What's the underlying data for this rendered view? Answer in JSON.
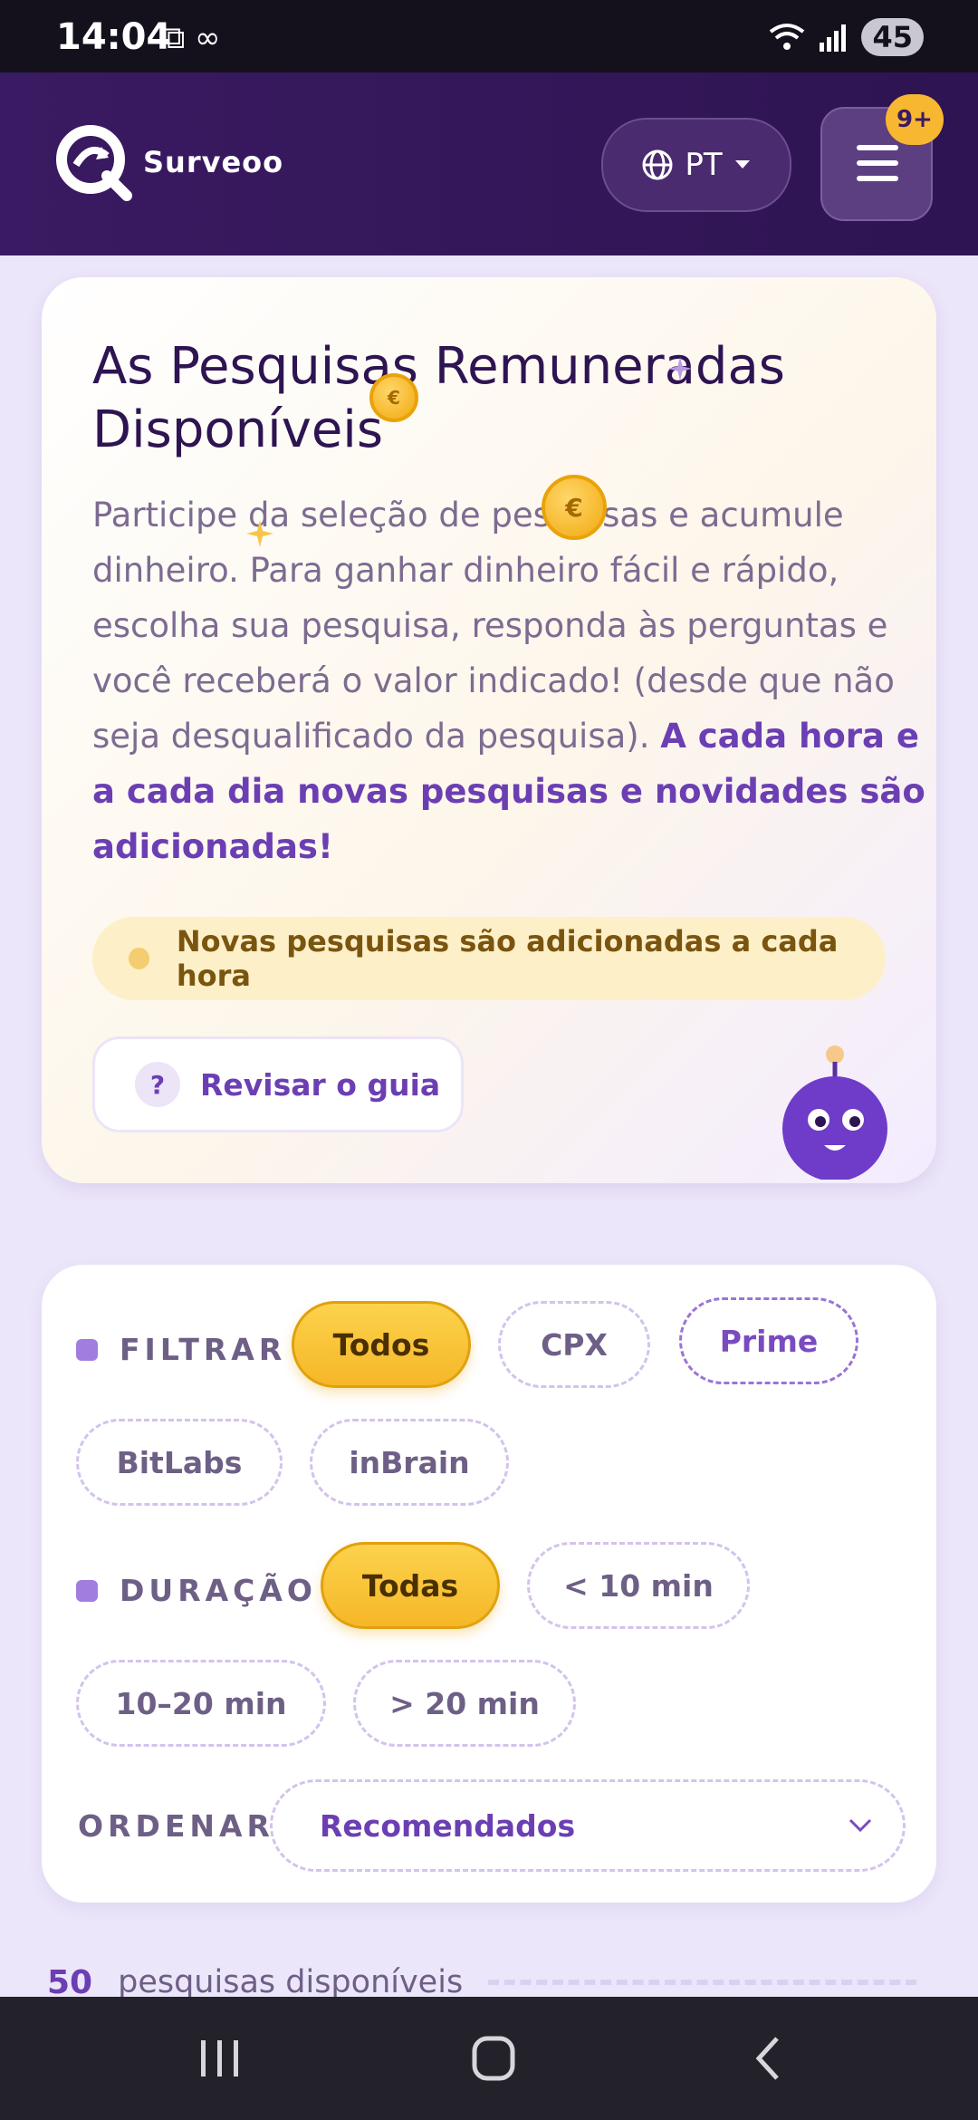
{
  "status_bar": {
    "time": "14:04",
    "left_icons": "⧉ ∞",
    "signal_icons": "📶",
    "battery": "45"
  },
  "header": {
    "brand": "Surveoo",
    "language": "PT",
    "notifications_badge": "9+"
  },
  "intro": {
    "title": "As Pesquisas Remuneradas Disponíveis",
    "body_regular": "Participe da seleção de pesquisas e acumule dinheiro. Para ganhar dinheiro fácil e rápido, escolha sua pesquisa, responda às perguntas e você receberá o valor indicado! (desde que não seja desqualificado da pesquisa). ",
    "body_bold": "A cada hora e a cada dia novas pesquisas e novidades são adicionadas!",
    "new_notice": "Novas pesquisas são adicionadas a cada hora",
    "guide_button": "Revisar o guia",
    "guide_icon_glyph": "?",
    "coin_glyph": "€"
  },
  "filters": {
    "filter_label": "FILTRAR",
    "filter_options": [
      "Todos",
      "CPX",
      "Prime",
      "BitLabs",
      "inBrain"
    ],
    "filter_selected": "Todos",
    "duration_label": "DURAÇÃO",
    "duration_options": [
      "Todas",
      "< 10 min",
      "10–20 min",
      "> 20 min"
    ],
    "duration_selected": "Todas",
    "sort_label": "ORDENAR",
    "sort_value": "Recomendados"
  },
  "results": {
    "count": "50",
    "label": "pesquisas disponíveis"
  },
  "colors": {
    "brand_purple": "#2e1452",
    "accent_purple": "#6b3fb3",
    "accent_yellow": "#f6b728",
    "page_bg": "#ece6fa"
  }
}
